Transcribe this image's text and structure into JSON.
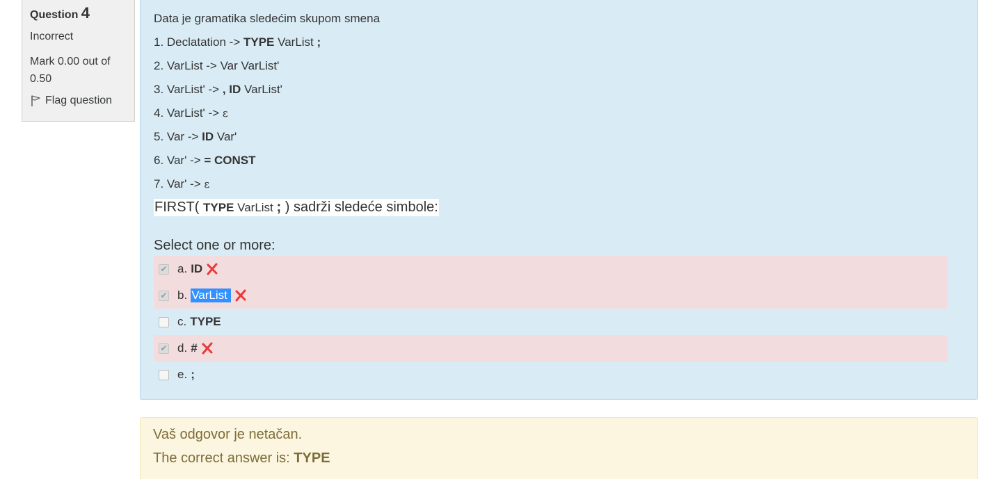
{
  "info": {
    "question_label": "Question",
    "question_number": "4",
    "state": "Incorrect",
    "grade": "Mark 0.00 out of 0.50",
    "flag_label": "Flag question"
  },
  "question": {
    "intro": "Data je gramatika sledećim skupom smena",
    "rules": [
      {
        "p1": "1. Declatation -> ",
        "b1": "TYPE",
        "p2": " VarList ",
        "b2": ";"
      },
      {
        "p1": "2. VarList -> Var VarList'"
      },
      {
        "p1": "3.  VarList' -> ",
        "b1": ", ID",
        "p2": " VarList'"
      },
      {
        "p1": "4. VarList' -> ",
        "eps": "ε"
      },
      {
        "p1": "5. Var -> ",
        "b1": "ID",
        "p2": " Var'"
      },
      {
        "p1": "6. Var' -> ",
        "b1": "= CONST"
      },
      {
        "p1": "7.  Var' -> ",
        "eps": "ε"
      }
    ],
    "first_line": {
      "prefix": "FIRST( ",
      "type_kw": "TYPE",
      "varlist": " VarList ",
      "semicolon": ";",
      "suffix": " ) sadrži sledeće simbole:"
    },
    "prompt": "Select one or more:"
  },
  "answers": [
    {
      "letter": "a.",
      "value": "ID",
      "checked": true,
      "incorrect": true
    },
    {
      "letter": "b.",
      "value": "VarList",
      "checked": true,
      "incorrect": true
    },
    {
      "letter": "c.",
      "value": "TYPE",
      "checked": false,
      "incorrect": false
    },
    {
      "letter": "d.",
      "value": "#",
      "checked": true,
      "incorrect": true
    },
    {
      "letter": "e.",
      "value": ";",
      "checked": false,
      "incorrect": false
    }
  ],
  "feedback": {
    "general": "Vaš odgovor je netačan.",
    "correct_prefix": "The correct answer is: ",
    "correct_value": "TYPE"
  },
  "colors": {
    "formulation_bg": "#d9ecf5",
    "incorrect_bg": "#f2dcde",
    "feedback_bg": "#fcf6e1",
    "cross": "#e83a3a",
    "selection": "#3390ff"
  }
}
